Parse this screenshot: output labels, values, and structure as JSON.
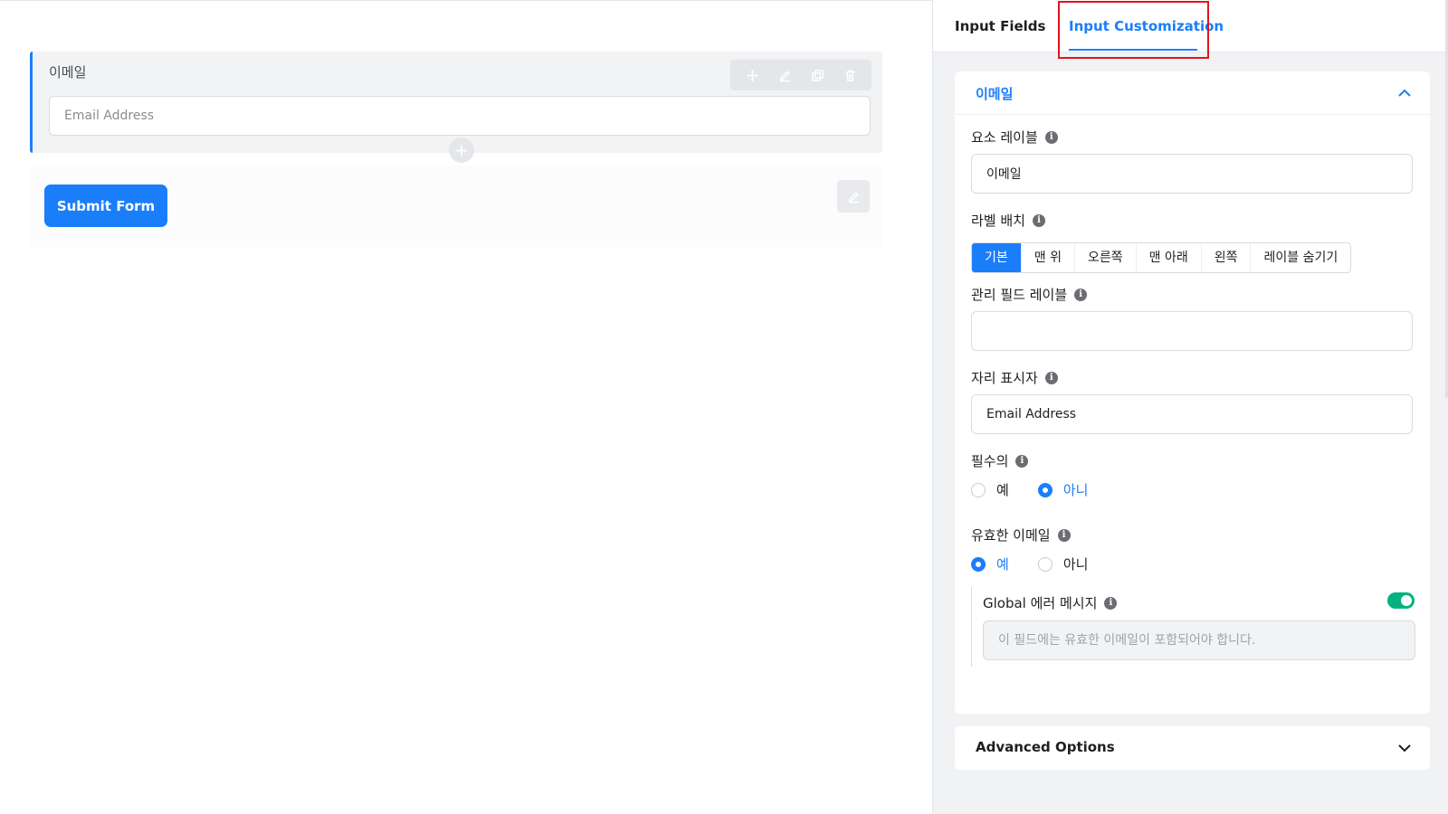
{
  "editor": {
    "field": {
      "label": "이메일",
      "placeholder": "Email Address",
      "actions": [
        "move-icon",
        "edit-icon",
        "duplicate-icon",
        "delete-icon"
      ]
    },
    "add_symbol": "+",
    "submit_label": "Submit Form"
  },
  "tabs": {
    "input_fields": "Input Fields",
    "input_customization": "Input Customization",
    "active": "input_customization"
  },
  "panel": {
    "section_title": "이메일",
    "element_label": {
      "label": "요소 레이블",
      "value": "이메일"
    },
    "label_placement": {
      "label": "라벨 배치",
      "options": [
        "기본",
        "맨 위",
        "오른쪽",
        "맨 아래",
        "왼쪽",
        "레이블 숨기기"
      ],
      "selected": "기본"
    },
    "admin_label": {
      "label": "관리 필드 레이블",
      "value": ""
    },
    "placeholder": {
      "label": "자리 표시자",
      "value": "Email Address"
    },
    "required": {
      "label": "필수의",
      "yes": "예",
      "no": "아니",
      "selected": "no"
    },
    "valid_email": {
      "label": "유효한 이메일",
      "yes": "예",
      "no": "아니",
      "selected": "yes"
    },
    "global_error": {
      "label": "Global 에러 메시지",
      "enabled": true,
      "placeholder": "이 필드에는 유효한 이메일이 포함되어야 합니다."
    },
    "advanced_title": "Advanced Options"
  },
  "colors": {
    "accent": "#1a7efb",
    "toggle_on": "#00b27f",
    "highlight": "#e0141e"
  },
  "info_glyph": "i"
}
